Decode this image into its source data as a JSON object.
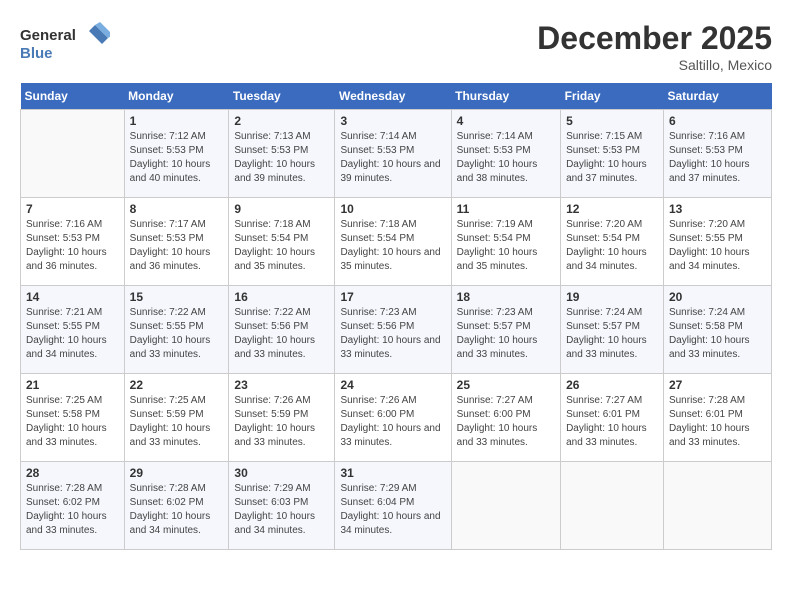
{
  "header": {
    "logo_line1": "General",
    "logo_line2": "Blue",
    "month": "December 2025",
    "location": "Saltillo, Mexico"
  },
  "days": [
    "Sunday",
    "Monday",
    "Tuesday",
    "Wednesday",
    "Thursday",
    "Friday",
    "Saturday"
  ],
  "weeks": [
    [
      {
        "num": "",
        "sunrise": "",
        "sunset": "",
        "daylight": ""
      },
      {
        "num": "1",
        "sunrise": "Sunrise: 7:12 AM",
        "sunset": "Sunset: 5:53 PM",
        "daylight": "Daylight: 10 hours and 40 minutes."
      },
      {
        "num": "2",
        "sunrise": "Sunrise: 7:13 AM",
        "sunset": "Sunset: 5:53 PM",
        "daylight": "Daylight: 10 hours and 39 minutes."
      },
      {
        "num": "3",
        "sunrise": "Sunrise: 7:14 AM",
        "sunset": "Sunset: 5:53 PM",
        "daylight": "Daylight: 10 hours and 39 minutes."
      },
      {
        "num": "4",
        "sunrise": "Sunrise: 7:14 AM",
        "sunset": "Sunset: 5:53 PM",
        "daylight": "Daylight: 10 hours and 38 minutes."
      },
      {
        "num": "5",
        "sunrise": "Sunrise: 7:15 AM",
        "sunset": "Sunset: 5:53 PM",
        "daylight": "Daylight: 10 hours and 37 minutes."
      },
      {
        "num": "6",
        "sunrise": "Sunrise: 7:16 AM",
        "sunset": "Sunset: 5:53 PM",
        "daylight": "Daylight: 10 hours and 37 minutes."
      }
    ],
    [
      {
        "num": "7",
        "sunrise": "Sunrise: 7:16 AM",
        "sunset": "Sunset: 5:53 PM",
        "daylight": "Daylight: 10 hours and 36 minutes."
      },
      {
        "num": "8",
        "sunrise": "Sunrise: 7:17 AM",
        "sunset": "Sunset: 5:53 PM",
        "daylight": "Daylight: 10 hours and 36 minutes."
      },
      {
        "num": "9",
        "sunrise": "Sunrise: 7:18 AM",
        "sunset": "Sunset: 5:54 PM",
        "daylight": "Daylight: 10 hours and 35 minutes."
      },
      {
        "num": "10",
        "sunrise": "Sunrise: 7:18 AM",
        "sunset": "Sunset: 5:54 PM",
        "daylight": "Daylight: 10 hours and 35 minutes."
      },
      {
        "num": "11",
        "sunrise": "Sunrise: 7:19 AM",
        "sunset": "Sunset: 5:54 PM",
        "daylight": "Daylight: 10 hours and 35 minutes."
      },
      {
        "num": "12",
        "sunrise": "Sunrise: 7:20 AM",
        "sunset": "Sunset: 5:54 PM",
        "daylight": "Daylight: 10 hours and 34 minutes."
      },
      {
        "num": "13",
        "sunrise": "Sunrise: 7:20 AM",
        "sunset": "Sunset: 5:55 PM",
        "daylight": "Daylight: 10 hours and 34 minutes."
      }
    ],
    [
      {
        "num": "14",
        "sunrise": "Sunrise: 7:21 AM",
        "sunset": "Sunset: 5:55 PM",
        "daylight": "Daylight: 10 hours and 34 minutes."
      },
      {
        "num": "15",
        "sunrise": "Sunrise: 7:22 AM",
        "sunset": "Sunset: 5:55 PM",
        "daylight": "Daylight: 10 hours and 33 minutes."
      },
      {
        "num": "16",
        "sunrise": "Sunrise: 7:22 AM",
        "sunset": "Sunset: 5:56 PM",
        "daylight": "Daylight: 10 hours and 33 minutes."
      },
      {
        "num": "17",
        "sunrise": "Sunrise: 7:23 AM",
        "sunset": "Sunset: 5:56 PM",
        "daylight": "Daylight: 10 hours and 33 minutes."
      },
      {
        "num": "18",
        "sunrise": "Sunrise: 7:23 AM",
        "sunset": "Sunset: 5:57 PM",
        "daylight": "Daylight: 10 hours and 33 minutes."
      },
      {
        "num": "19",
        "sunrise": "Sunrise: 7:24 AM",
        "sunset": "Sunset: 5:57 PM",
        "daylight": "Daylight: 10 hours and 33 minutes."
      },
      {
        "num": "20",
        "sunrise": "Sunrise: 7:24 AM",
        "sunset": "Sunset: 5:58 PM",
        "daylight": "Daylight: 10 hours and 33 minutes."
      }
    ],
    [
      {
        "num": "21",
        "sunrise": "Sunrise: 7:25 AM",
        "sunset": "Sunset: 5:58 PM",
        "daylight": "Daylight: 10 hours and 33 minutes."
      },
      {
        "num": "22",
        "sunrise": "Sunrise: 7:25 AM",
        "sunset": "Sunset: 5:59 PM",
        "daylight": "Daylight: 10 hours and 33 minutes."
      },
      {
        "num": "23",
        "sunrise": "Sunrise: 7:26 AM",
        "sunset": "Sunset: 5:59 PM",
        "daylight": "Daylight: 10 hours and 33 minutes."
      },
      {
        "num": "24",
        "sunrise": "Sunrise: 7:26 AM",
        "sunset": "Sunset: 6:00 PM",
        "daylight": "Daylight: 10 hours and 33 minutes."
      },
      {
        "num": "25",
        "sunrise": "Sunrise: 7:27 AM",
        "sunset": "Sunset: 6:00 PM",
        "daylight": "Daylight: 10 hours and 33 minutes."
      },
      {
        "num": "26",
        "sunrise": "Sunrise: 7:27 AM",
        "sunset": "Sunset: 6:01 PM",
        "daylight": "Daylight: 10 hours and 33 minutes."
      },
      {
        "num": "27",
        "sunrise": "Sunrise: 7:28 AM",
        "sunset": "Sunset: 6:01 PM",
        "daylight": "Daylight: 10 hours and 33 minutes."
      }
    ],
    [
      {
        "num": "28",
        "sunrise": "Sunrise: 7:28 AM",
        "sunset": "Sunset: 6:02 PM",
        "daylight": "Daylight: 10 hours and 33 minutes."
      },
      {
        "num": "29",
        "sunrise": "Sunrise: 7:28 AM",
        "sunset": "Sunset: 6:02 PM",
        "daylight": "Daylight: 10 hours and 34 minutes."
      },
      {
        "num": "30",
        "sunrise": "Sunrise: 7:29 AM",
        "sunset": "Sunset: 6:03 PM",
        "daylight": "Daylight: 10 hours and 34 minutes."
      },
      {
        "num": "31",
        "sunrise": "Sunrise: 7:29 AM",
        "sunset": "Sunset: 6:04 PM",
        "daylight": "Daylight: 10 hours and 34 minutes."
      },
      {
        "num": "",
        "sunrise": "",
        "sunset": "",
        "daylight": ""
      },
      {
        "num": "",
        "sunrise": "",
        "sunset": "",
        "daylight": ""
      },
      {
        "num": "",
        "sunrise": "",
        "sunset": "",
        "daylight": ""
      }
    ]
  ]
}
